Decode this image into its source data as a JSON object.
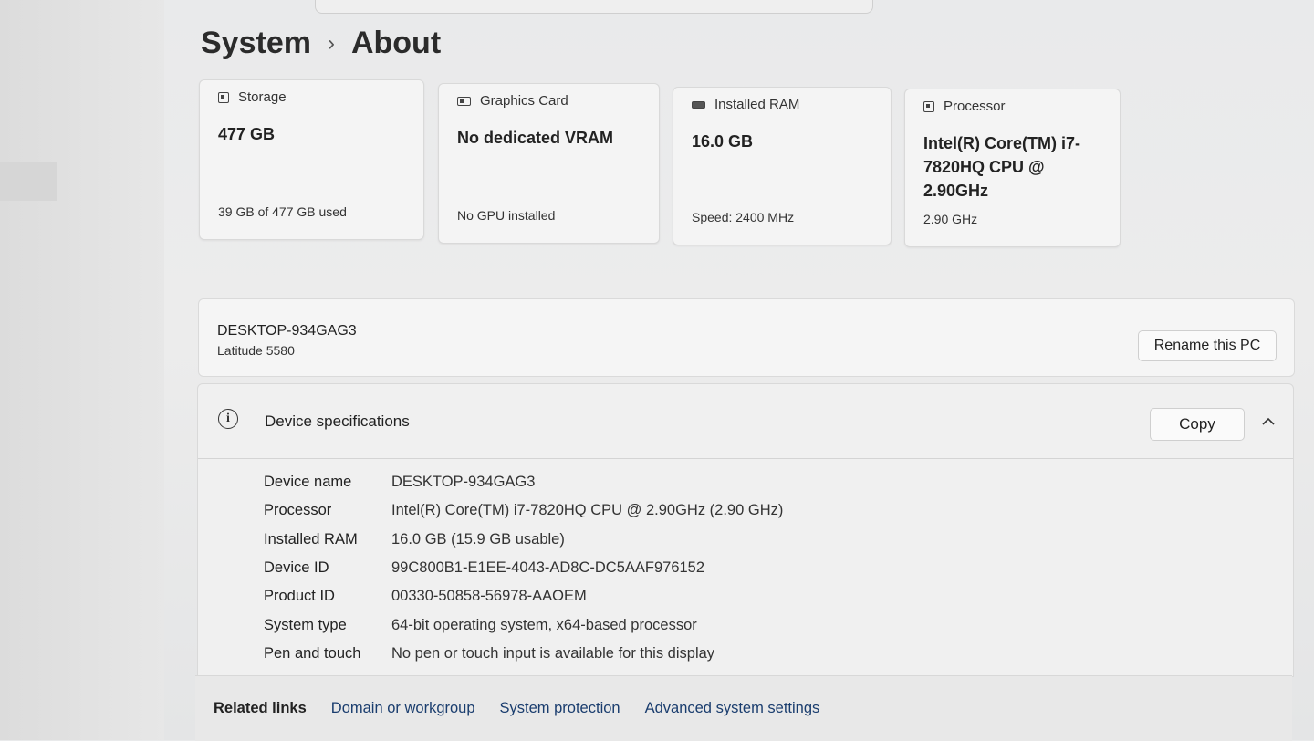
{
  "breadcrumb": {
    "parent": "System",
    "separator": "›",
    "current": "About"
  },
  "cards": {
    "storage": {
      "title": "Storage",
      "value": "477 GB",
      "sub": "39 GB of 477 GB used"
    },
    "graphics": {
      "title": "Graphics Card",
      "value": "No dedicated VRAM",
      "sub": "No GPU installed"
    },
    "ram": {
      "title": "Installed RAM",
      "value": "16.0 GB",
      "sub": "Speed: 2400 MHz"
    },
    "processor": {
      "title": "Processor",
      "value": "Intel(R) Core(TM) i7-7820HQ CPU @ 2.90GHz",
      "sub": "2.90 GHz"
    }
  },
  "pc": {
    "name": "DESKTOP-934GAG3",
    "model": "Latitude 5580",
    "rename_label": "Rename this PC"
  },
  "specs": {
    "title": "Device specifications",
    "copy_label": "Copy",
    "rows": [
      {
        "label": "Device name",
        "value": "DESKTOP-934GAG3"
      },
      {
        "label": "Processor",
        "value": "Intel(R) Core(TM) i7-7820HQ CPU @ 2.90GHz (2.90 GHz)"
      },
      {
        "label": "Installed RAM",
        "value": "16.0 GB (15.9 GB usable)"
      },
      {
        "label": "Device ID",
        "value": "99C800B1-E1EE-4043-AD8C-DC5AAF976152"
      },
      {
        "label": "Product ID",
        "value": "00330-50858-56978-AAOEM"
      },
      {
        "label": "System type",
        "value": "64-bit operating system, x64-based processor"
      },
      {
        "label": "Pen and touch",
        "value": "No pen or touch input is available for this display"
      }
    ]
  },
  "related": {
    "label": "Related links",
    "links": [
      "Domain or workgroup",
      "System protection",
      "Advanced system settings"
    ]
  }
}
